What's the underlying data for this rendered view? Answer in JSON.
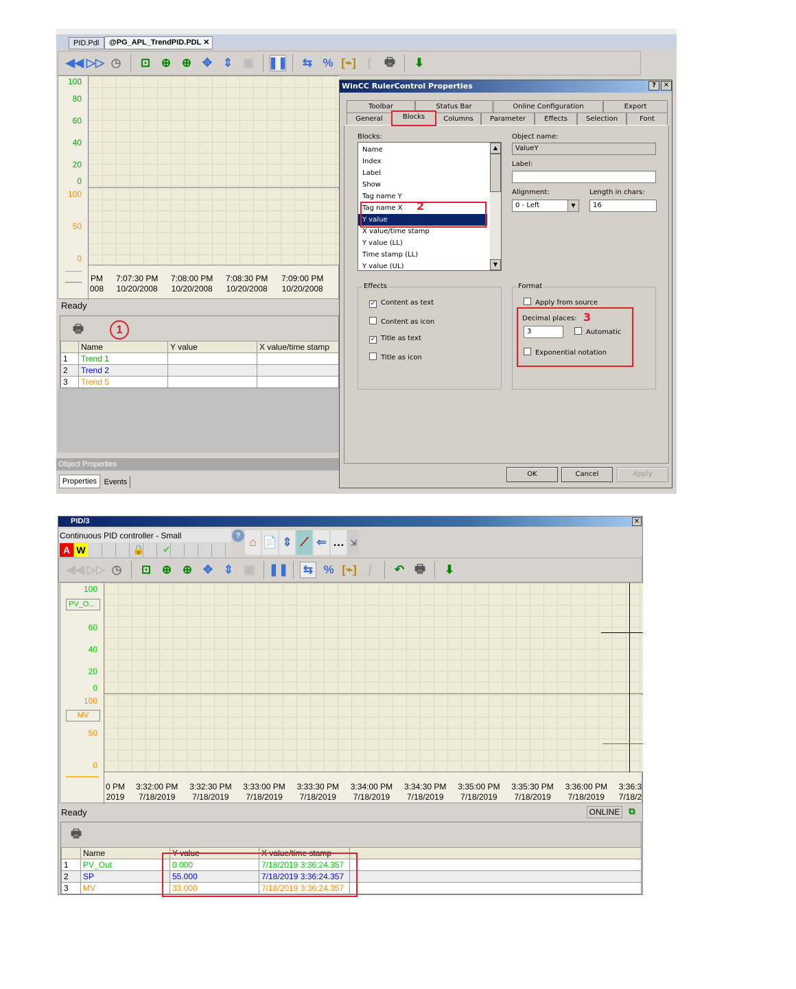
{
  "top": {
    "doc_tabs": [
      "PID.Pdl",
      "@PG_APL_TrendPID.PDL"
    ],
    "upper_axis": [
      "100",
      "80",
      "60",
      "40",
      "20",
      "0"
    ],
    "lower_axis": [
      "100",
      "50",
      "0"
    ],
    "time_labels": [
      [
        "PM",
        "008"
      ],
      [
        "7:07:30 PM",
        "10/20/2008"
      ],
      [
        "7:08:00 PM",
        "10/20/2008"
      ],
      [
        "7:08:30 PM",
        "10/20/2008"
      ],
      [
        "7:09:00 PM",
        "10/20/2008"
      ]
    ],
    "status": "Ready",
    "marker1": "1",
    "table": {
      "headers": [
        "Name",
        "Y value",
        "X value/time stamp"
      ],
      "rows": [
        {
          "idx": "1",
          "name": "Trend 1",
          "color": "#00aa00"
        },
        {
          "idx": "2",
          "name": "Trend 2",
          "color": "#0000ff"
        },
        {
          "idx": "3",
          "name": "Trend 5",
          "color": "#ff8c00"
        }
      ]
    },
    "object_properties": "Object Properties",
    "bottom_tabs": [
      "Properties",
      "Events"
    ]
  },
  "dialog": {
    "title": "WinCC RulerControl Properties",
    "help": "?",
    "close": "✕",
    "tabs_row1": [
      "Toolbar",
      "Status Bar",
      "Online Configuration",
      "Export"
    ],
    "tabs_row2": [
      "General",
      "Blocks",
      "Columns",
      "Parameter",
      "Effects",
      "Selection",
      "Font"
    ],
    "blocks_label": "Blocks:",
    "blocks": [
      "Name",
      "Index",
      "Label",
      "Show",
      "Tag name Y",
      "Tag name X",
      "Y value",
      "X value/time stamp",
      "Y value (LL)",
      "Time stamp (LL)",
      "Y value (UL)"
    ],
    "selected_block": "Y value",
    "marker2": "2",
    "object_name_label": "Object name:",
    "object_name": "ValueY",
    "label_label": "Label:",
    "label_value": "",
    "alignment_label": "Alignment:",
    "alignment": "0 - Left",
    "length_label": "Length in chars:",
    "length": "16",
    "effects": {
      "title": "Effects",
      "items": [
        {
          "label": "Content as text",
          "checked": true
        },
        {
          "label": "Content as icon",
          "checked": false
        },
        {
          "label": "Title as text",
          "checked": true
        },
        {
          "label": "Title as icon",
          "checked": false
        }
      ]
    },
    "format": {
      "title": "Format",
      "apply_from_source": "Apply from source",
      "decimal_label": "Decimal places:",
      "decimal": "3",
      "automatic": "Automatic",
      "exponential": "Exponential notation"
    },
    "marker3": "3",
    "ok": "OK",
    "cancel": "Cancel",
    "apply": "Apply"
  },
  "bottom": {
    "title": "PID/3",
    "close": "✕",
    "faceplate": "Continuous PID controller - Small",
    "alarm_a": "A",
    "alarm_w": "W",
    "upper_axis": [
      "100",
      "60",
      "40",
      "20",
      "0"
    ],
    "pv_label": "PV_O...",
    "lower_axis": [
      "100",
      "50",
      "0"
    ],
    "mv_label": "MV",
    "time_labels": [
      [
        "0 PM",
        "2019"
      ],
      [
        "3:32:00 PM",
        "7/18/2019"
      ],
      [
        "3:32:30 PM",
        "7/18/2019"
      ],
      [
        "3:33:00 PM",
        "7/18/2019"
      ],
      [
        "3:33:30 PM",
        "7/18/2019"
      ],
      [
        "3:34:00 PM",
        "7/18/2019"
      ],
      [
        "3:34:30 PM",
        "7/18/2019"
      ],
      [
        "3:35:00 PM",
        "7/18/2019"
      ],
      [
        "3:35:30 PM",
        "7/18/2019"
      ],
      [
        "3:36:00 PM",
        "7/18/2019"
      ],
      [
        "3:36:3",
        "7/18/2"
      ]
    ],
    "status": "Ready",
    "online": "ONLINE",
    "table": {
      "headers": [
        "Name",
        "Y value",
        "X value/time stamp"
      ],
      "rows": [
        {
          "idx": "1",
          "name": "PV_Out",
          "y": "0.000",
          "x": "7/18/2019 3:36:24.357",
          "color": "#00cc00"
        },
        {
          "idx": "2",
          "name": "SP",
          "y": "55.000",
          "x": "7/18/2019 3:36:24.357",
          "color": "#0000ff"
        },
        {
          "idx": "3",
          "name": "MV",
          "y": "33.000",
          "x": "7/18/2019 3:36:24.357",
          "color": "#ff8c00"
        }
      ]
    }
  }
}
